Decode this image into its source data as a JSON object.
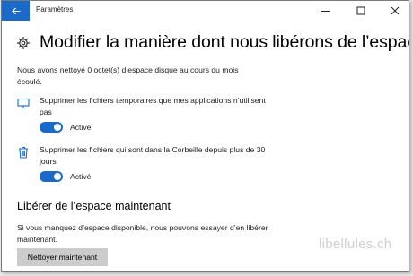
{
  "window": {
    "title": "Paramètres",
    "back_icon": "back-arrow-icon",
    "controls": [
      "minimize-icon",
      "maximize-icon",
      "close-icon"
    ]
  },
  "header": {
    "icon": "gear-icon",
    "title": "Modifier la manière dont nous libérons de l’espace"
  },
  "description": "Nous avons nettoyé 0 octet(s) d’espace disque au cours du mois écoulé.",
  "options": [
    {
      "icon": "monitor-icon",
      "text": "Supprimer les fichiers temporaires que mes applications n’utilisent pas",
      "toggle_label": "Activé",
      "on": true
    },
    {
      "icon": "trash-icon",
      "text": "Supprimer les fichiers qui sont dans la Corbeille depuis plus de 30 jours",
      "toggle_label": "Activé",
      "on": true
    }
  ],
  "free_now": {
    "title": "Libérer de l’espace maintenant",
    "description": "Si vous manquez d’espace disponible, nous pouvons essayer d’en libérer maintenant.",
    "button_label": "Nettoyer maintenant"
  },
  "watermark": "libellules.ch",
  "colors": {
    "accent": "#1b6ac9",
    "button_bg": "#cccccc"
  }
}
